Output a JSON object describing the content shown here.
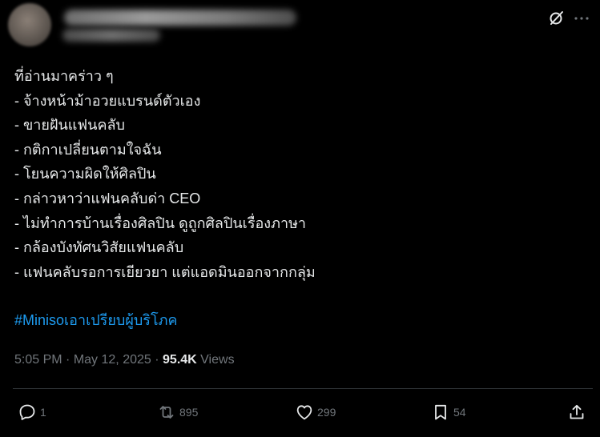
{
  "post": {
    "lines": [
      "ที่อ่านมาคร่าว ๆ",
      "- จ้างหน้าม้าอวยแบรนด์ตัวเอง",
      "- ขายฝันแฟนคลับ",
      "- กติกาเปลี่ยนตามใจฉัน",
      "- โยนความผิดให้ศิลปิน",
      "- กล่าวหาว่าแฟนคลับด่า CEO",
      "- ไม่ทำการบ้านเรื่องศิลปิน ดูถูกศิลปินเรื่องภาษา",
      "- กล้องบังทัศนวิสัยแฟนคลับ",
      "- แฟนคลับรอการเยียวยา แต่แอดมินออกจากกลุ่ม"
    ],
    "hashtag": "#Minisoเอาเปรียบผู้บริโภค"
  },
  "meta": {
    "time": "5:05 PM",
    "separator": "·",
    "date": "May 12, 2025",
    "views_count": "95.4K",
    "views_label": "Views"
  },
  "actions": {
    "replies": "1",
    "reposts": "895",
    "likes": "299",
    "bookmarks": "54"
  },
  "colors": {
    "background": "#000000",
    "text": "#e7e9ea",
    "secondary": "#71767b",
    "link": "#1d9bf0",
    "divider": "#2f3336"
  },
  "icons": {
    "header": [
      "grok-icon",
      "more-icon"
    ],
    "actions": [
      "reply-icon",
      "repost-icon",
      "like-icon",
      "bookmark-icon",
      "share-icon"
    ]
  }
}
